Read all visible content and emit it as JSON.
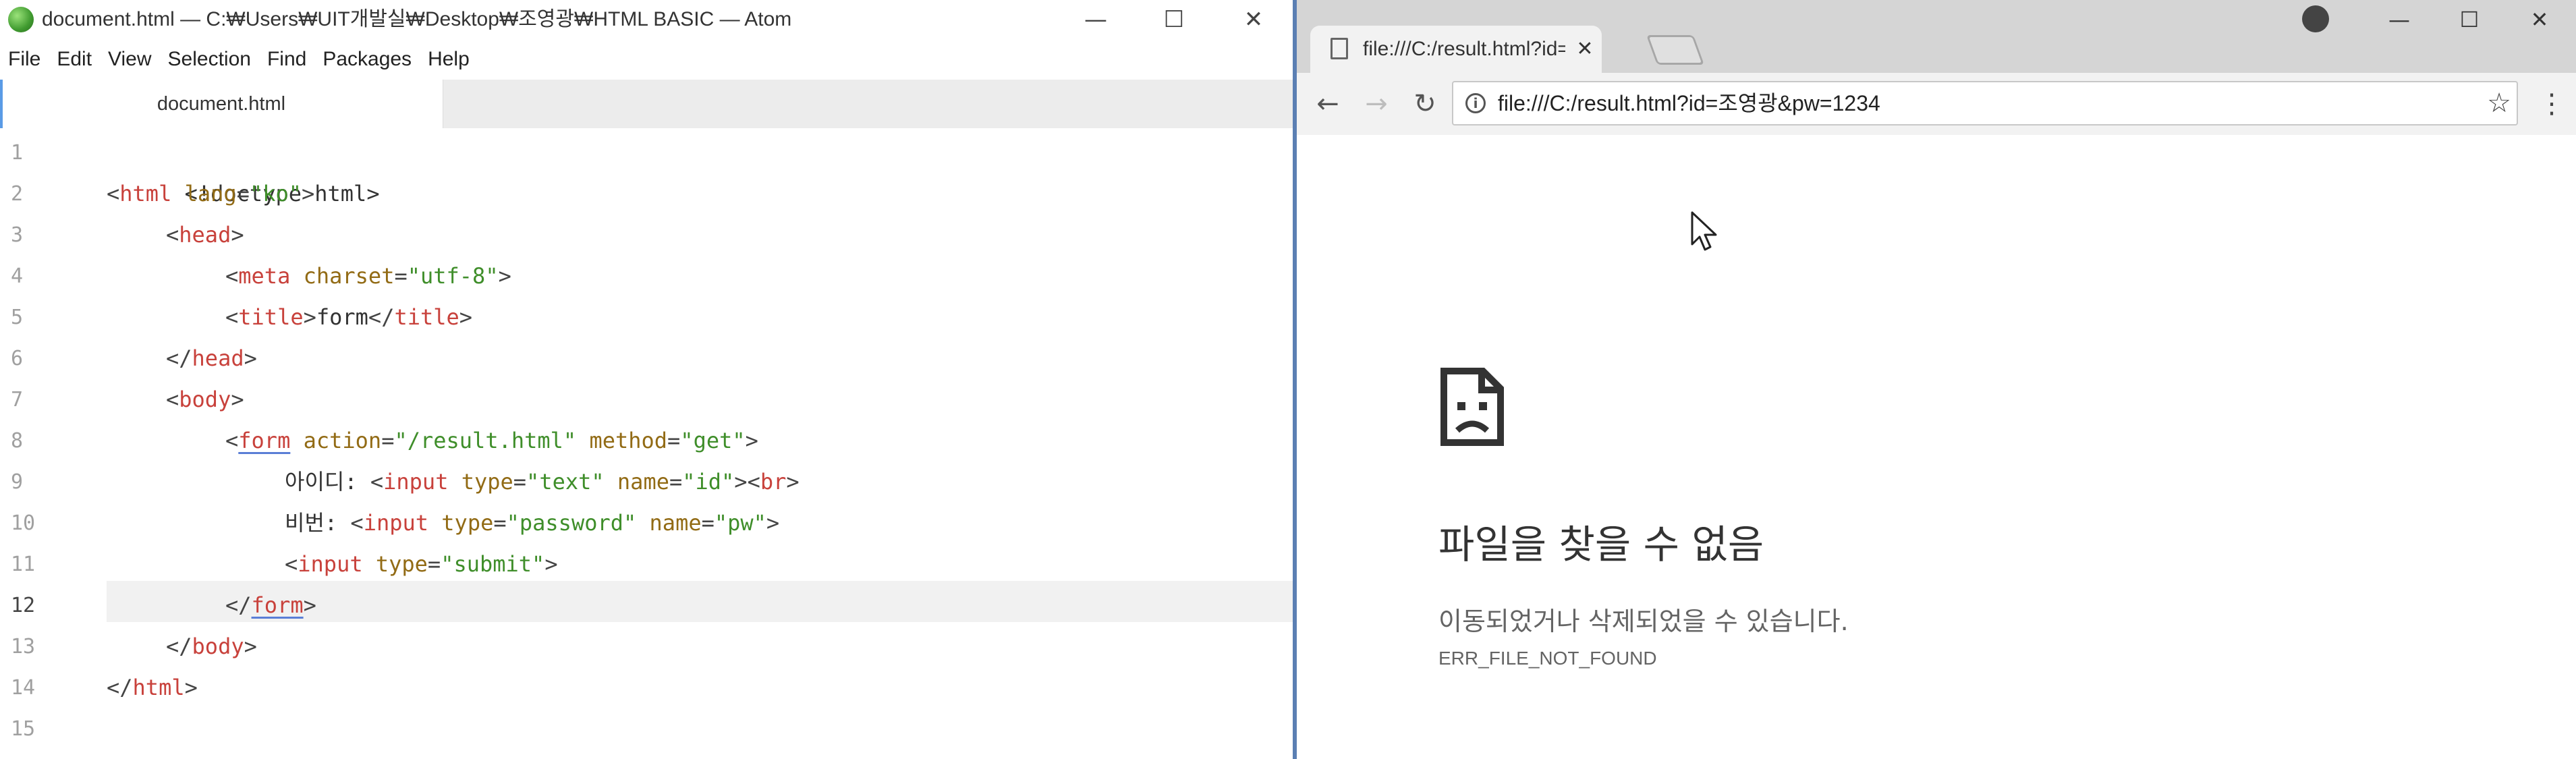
{
  "atom": {
    "window_title": "document.html — C:₩Users₩UIT개발실₩Desktop₩조영광₩HTML BASIC — Atom",
    "window_controls": {
      "minimize": "—",
      "maximize": "☐",
      "close": "✕"
    },
    "menu": [
      "File",
      "Edit",
      "View",
      "Selection",
      "Find",
      "Packages",
      "Help"
    ],
    "tab_label": "document.html",
    "line_numbers": [
      "1",
      "2",
      "3",
      "4",
      "5",
      "6",
      "7",
      "8",
      "9",
      "10",
      "11",
      "12",
      "13",
      "14",
      "15"
    ],
    "current_line": 12,
    "code": {
      "l1": "<!doctype html>",
      "l2": {
        "lt": "<",
        "tag": "html",
        "sp": " ",
        "attr": "lang",
        "eq": "=",
        "val": "\"ko\"",
        "gt": ">"
      },
      "l3": {
        "lt": "<",
        "tag": "head",
        "gt": ">"
      },
      "l4": {
        "lt": "<",
        "tag": "meta",
        "sp": " ",
        "attr": "charset",
        "eq": "=",
        "val": "\"utf-8\"",
        "gt": ">"
      },
      "l5": {
        "lt": "<",
        "tag": "title",
        "gt": ">",
        "text": "form",
        "lt2": "</",
        "tag2": "title",
        "gt2": ">"
      },
      "l6": {
        "lt": "</",
        "tag": "head",
        "gt": ">"
      },
      "l7": {
        "lt": "<",
        "tag": "body",
        "gt": ">"
      },
      "l8": {
        "lt": "<",
        "tag": "form",
        "sp": " ",
        "attr1": "action",
        "eq1": "=",
        "val1": "\"/result.html\"",
        "sp2": " ",
        "attr2": "method",
        "eq2": "=",
        "val2": "\"get\"",
        "gt": ">"
      },
      "l9": {
        "label": "아이디: ",
        "lt": "<",
        "tag": "input",
        "sp": " ",
        "attr1": "type",
        "eq1": "=",
        "val1": "\"text\"",
        "sp2": " ",
        "attr2": "name",
        "eq2": "=",
        "val2": "\"id\"",
        "gt": ">",
        "lt2": "<",
        "tag2": "br",
        "gt2": ">"
      },
      "l10": {
        "label": "비번: ",
        "lt": "<",
        "tag": "input",
        "sp": " ",
        "attr1": "type",
        "eq1": "=",
        "val1": "\"password\"",
        "sp2": " ",
        "attr2": "name",
        "eq2": "=",
        "val2": "\"pw\"",
        "gt": ">"
      },
      "l11": {
        "lt": "<",
        "tag": "input",
        "sp": " ",
        "attr1": "type",
        "eq1": "=",
        "val1": "\"submit\"",
        "gt": ">"
      },
      "l12": {
        "lt": "</",
        "tag": "form",
        "gt": ">"
      },
      "l13": {
        "lt": "</",
        "tag": "body",
        "gt": ">"
      },
      "l14": {
        "lt": "</",
        "tag": "html",
        "gt": ">"
      }
    },
    "colors": {
      "tag": "#c8413b",
      "attr": "#926b15",
      "string": "#3f8e2a",
      "text": "#333333"
    }
  },
  "chrome": {
    "tab_title": "file:///C:/result.html?id=조",
    "tab_close": "✕",
    "window_controls": {
      "minimize": "—",
      "maximize": "☐",
      "close": "✕"
    },
    "nav": {
      "back": "←",
      "forward": "→",
      "reload": "↻"
    },
    "info_icon": "i",
    "url": "file:///C:/result.html?id=조영광&pw=1234",
    "star": "☆",
    "menu": "⋮",
    "error": {
      "title": "파일을 찾을 수 없음",
      "description": "이동되었거나 삭제되었을 수 있습니다.",
      "code": "ERR_FILE_NOT_FOUND"
    }
  }
}
